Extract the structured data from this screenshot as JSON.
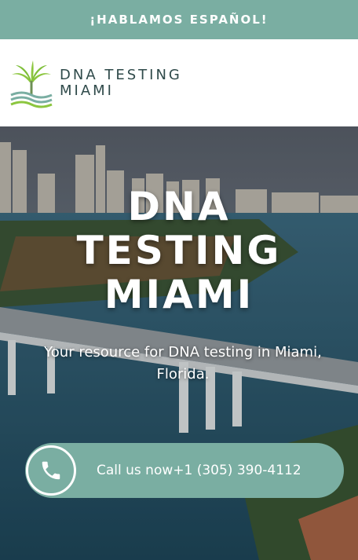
{
  "topbar": {
    "text": "¡HABLAMOS ESPAÑOL!"
  },
  "brand": {
    "line1": "DNA TESTING",
    "line2": "MIAMI"
  },
  "hero": {
    "title_lines": [
      "DNA",
      "TESTING",
      "MIAMI"
    ],
    "subtitle": "Your resource for DNA testing in Miami, Florida."
  },
  "cta": {
    "label": "Call us now+1 (305) 390-4112"
  },
  "colors": {
    "accent": "#7aaea2",
    "logo_green": "#8cc63f",
    "text_dark": "#2f4a4a"
  }
}
